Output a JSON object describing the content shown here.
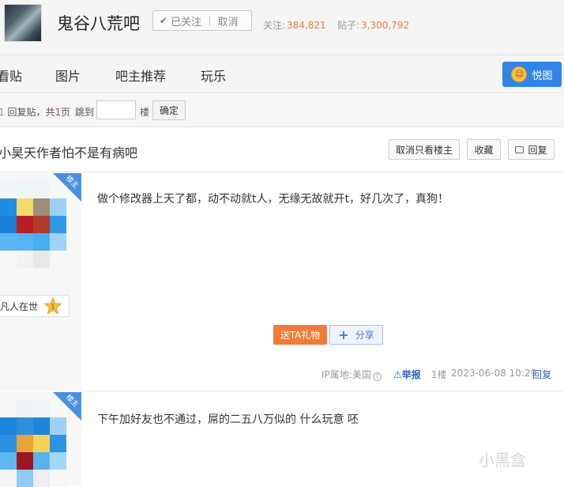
{
  "header": {
    "forum_name": "鬼谷八荒吧",
    "follow_label": "已关注",
    "unfollow_label": "取消",
    "followers_label": "关注:",
    "followers_count": "384,821",
    "posts_label": "贴子:",
    "posts_count": "3,300,792"
  },
  "nav": {
    "items": [
      "看贴",
      "图片",
      "吧主推荐",
      "玩乐"
    ],
    "yuetu_label": "悦图"
  },
  "pager": {
    "replies_prefix": "回复贴，共",
    "pages_count": "1",
    "pages_suffix": "页",
    "jump_label": "跳到",
    "floor_label": "楼",
    "confirm_label": "确定"
  },
  "thread": {
    "title": "小昊天作者怕不是有病吧",
    "only_op_button": "取消只看楼主",
    "favorite_button": "收藏",
    "reply_button": "回复"
  },
  "posts": [
    {
      "badge": "楼主",
      "level_name": "凡人在世",
      "level_num": "1",
      "content": "做个修改器上天了都，动不动就t人，无缘无故就开t，好几次了，真狗！",
      "gift_label": "送TA礼物",
      "share_label": "分享",
      "ip_label": "IP属地:美国",
      "report_label": "举报",
      "floor": "1楼",
      "date": "2023-06-08 10:29",
      "reply_label": "回复"
    },
    {
      "badge": "楼主",
      "content": "下午加好友也不通过，屌的二五八万似的 什么玩意 呸"
    }
  ],
  "watermark": "小黑盒",
  "colors": {
    "accent_blue": "#3285e8",
    "stat_orange": "#f07c40",
    "gift_orange": "#f07b38",
    "op_badge_blue": "#4a90e2"
  }
}
